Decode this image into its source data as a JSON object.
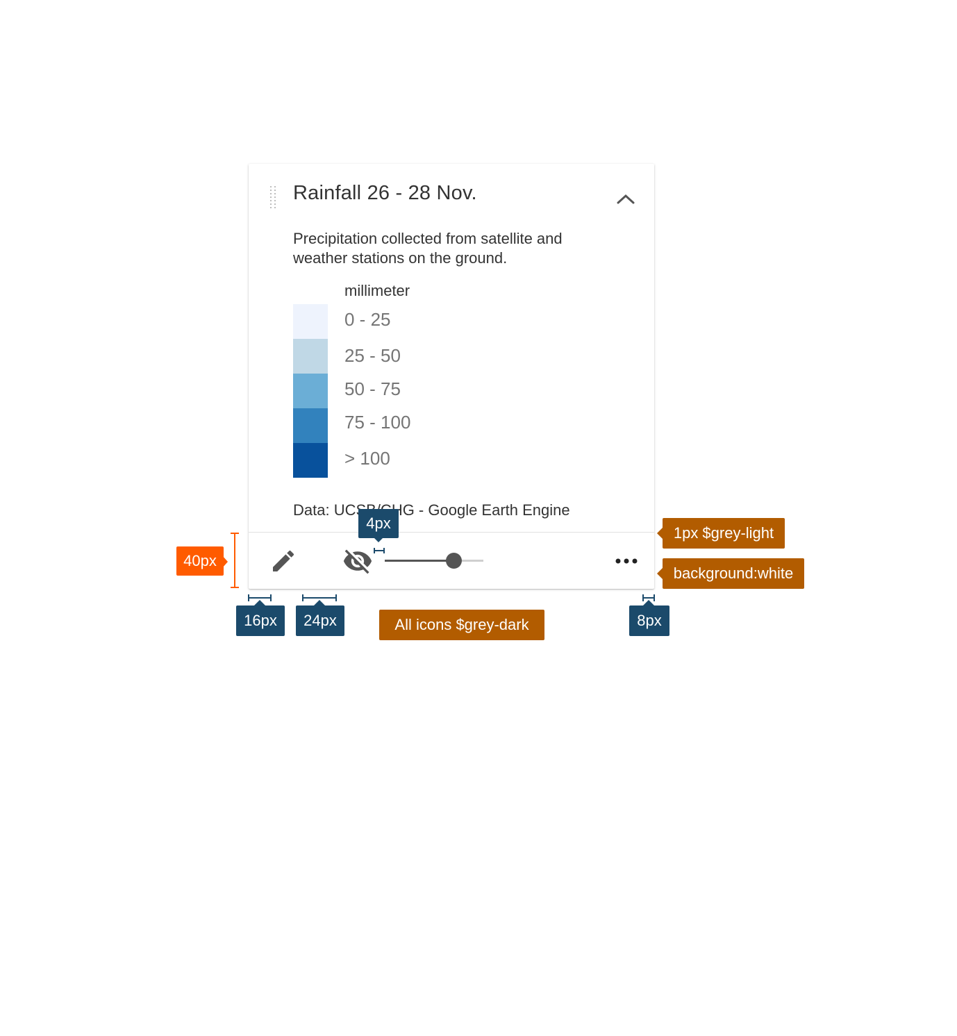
{
  "layer_card": {
    "title": "Rainfall 26 - 28 Nov.",
    "description": "Precipitation collected from satellite and weather stations on the ground.",
    "legend": {
      "unit": "millimeter",
      "items": [
        {
          "label": "0 - 25",
          "color": "#eef3fd"
        },
        {
          "label": "25 - 50",
          "color": "#c0d8e6"
        },
        {
          "label": "50 - 75",
          "color": "#6baed6"
        },
        {
          "label": "75 - 100",
          "color": "#3282bd"
        },
        {
          "label": "> 100",
          "color": "#08519c"
        }
      ]
    },
    "source": "Data: UCSB/CHG - Google Earth Engine",
    "footer": {
      "icons": [
        "pencil-icon",
        "visibility-off-icon",
        "more-horizontal-icon"
      ],
      "opacity": 0.7
    }
  },
  "annotations": {
    "height_40": "40px",
    "gap_4": "4px",
    "border_note": "1px $grey-light",
    "background_note": "background:white",
    "left_16": "16px",
    "gap_24": "24px",
    "icons_note": "All icons $grey-dark",
    "right_8": "8px"
  },
  "colors": {
    "grey_dark": "#555555",
    "grey_light": "#e0e0e0",
    "annotation_blue": "#1b4a6b",
    "annotation_orange": "#b25c00",
    "annotation_red": "#ff5b00"
  }
}
